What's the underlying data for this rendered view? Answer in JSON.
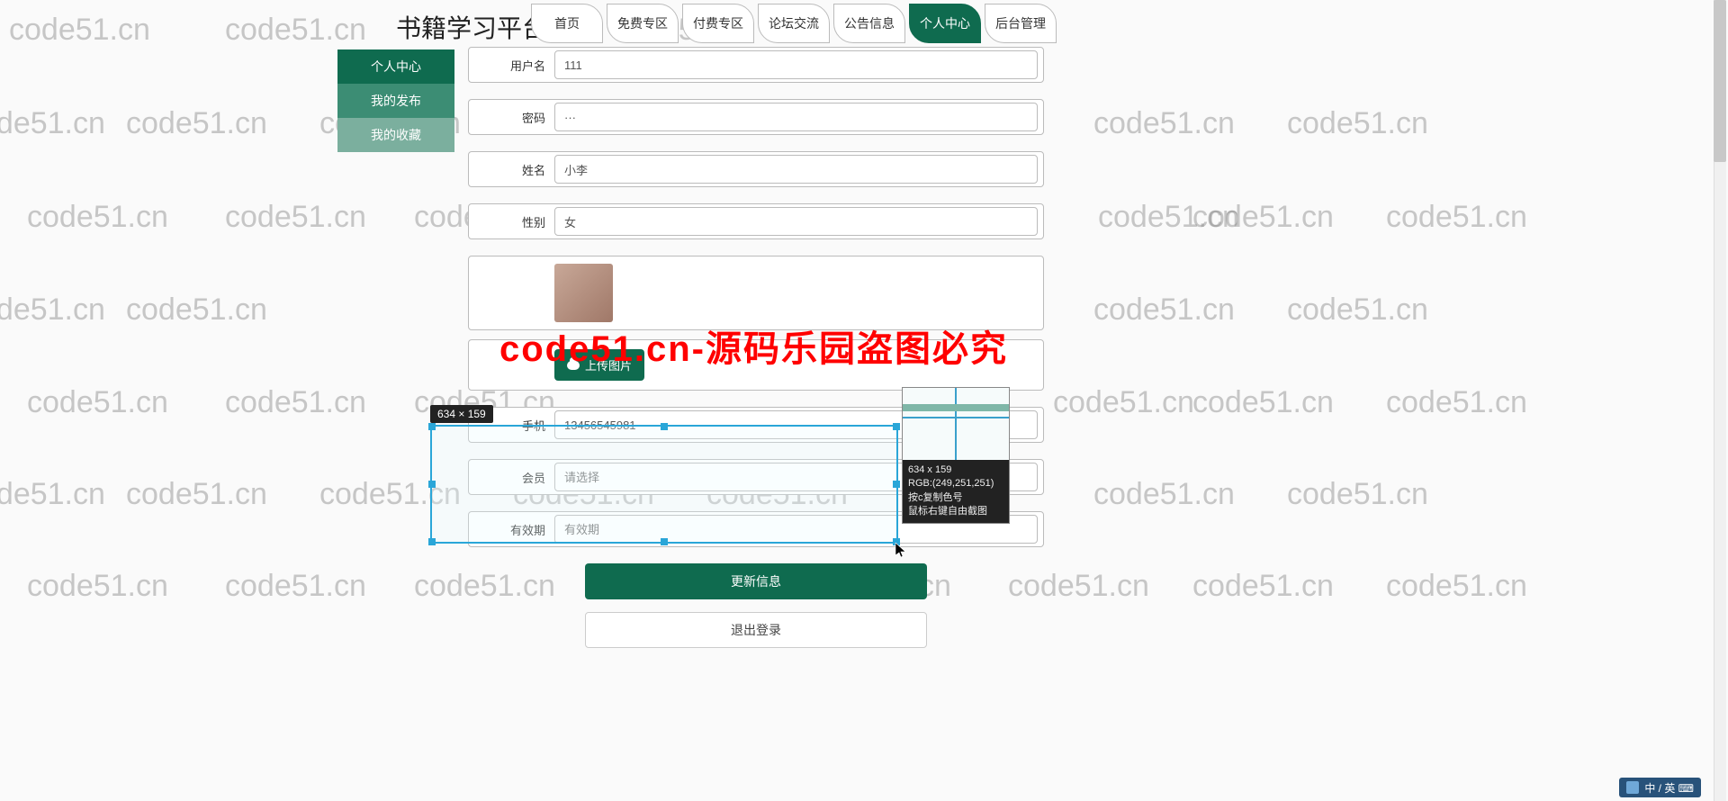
{
  "brand": "书籍学习平台",
  "watermark_text": "code51.cn",
  "watermark_red": "code51.cn-源码乐园盗图必究",
  "nav": [
    {
      "label": "首页",
      "active": false
    },
    {
      "label": "免费专区",
      "active": false
    },
    {
      "label": "付费专区",
      "active": false
    },
    {
      "label": "论坛交流",
      "active": false
    },
    {
      "label": "公告信息",
      "active": false
    },
    {
      "label": "个人中心",
      "active": true
    },
    {
      "label": "后台管理",
      "active": false
    }
  ],
  "sidebar": [
    {
      "label": "个人中心",
      "cls": "top"
    },
    {
      "label": "我的发布",
      "cls": "a"
    },
    {
      "label": "我的收藏",
      "cls": "b"
    }
  ],
  "form": {
    "username_label": "用户名",
    "username_value": "111",
    "password_label": "密码",
    "password_value": "···",
    "name_label": "姓名",
    "name_value": "小李",
    "gender_label": "性别",
    "gender_value": "女",
    "upload_label": "上传图片",
    "phone_label": "手机",
    "phone_value": "13456545981",
    "member_label": "会员",
    "member_placeholder": "请选择",
    "expire_label": "有效期",
    "expire_placeholder": "有效期"
  },
  "actions": {
    "update": "更新信息",
    "logout": "退出登录"
  },
  "capture": {
    "size_badge": "634 × 159",
    "info_size": "634 x 159",
    "info_rgb": "RGB:(249,251,251)",
    "info_copy": "按c复制色号",
    "info_right": "鼠标右键自由截图"
  },
  "ime_text": "中 / 英 ⌨"
}
